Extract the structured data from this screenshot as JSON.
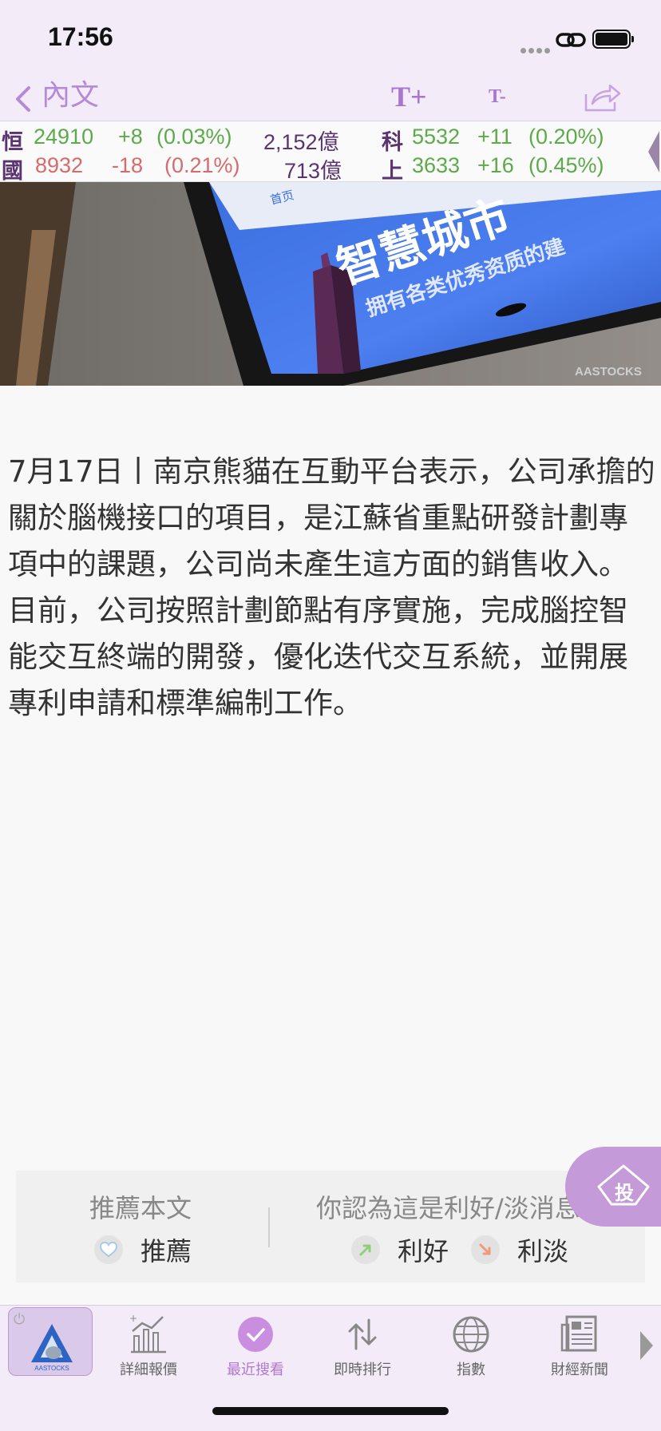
{
  "status_bar": {
    "time": "17:56"
  },
  "nav": {
    "title": "內文",
    "font_increase": "T+",
    "font_decrease": "T-"
  },
  "ticker": {
    "rows": [
      {
        "left": {
          "name": "恒",
          "value": "24910",
          "change": "+8",
          "percent": "(0.03%)",
          "turnover": "2,152億",
          "direction": "up"
        },
        "right": {
          "name": "科",
          "value": "5532",
          "change": "+11",
          "percent": "(0.20%)",
          "direction": "up"
        }
      },
      {
        "left": {
          "name": "國",
          "value": "8932",
          "change": "-18",
          "percent": "(0.21%)",
          "turnover": "713億",
          "direction": "down"
        },
        "right": {
          "name": "上",
          "value": "3633",
          "change": "+16",
          "percent": "(0.45%)",
          "direction": "up"
        }
      }
    ]
  },
  "hero": {
    "headline": "智慧城市",
    "subline": "拥有各类优秀资质的建",
    "tab_text": "首页",
    "watermark": "AASTOCKS"
  },
  "article": {
    "body": "7月17日丨南京熊貓在互動平台表示，公司承擔的關於腦機接口的項目，是江蘇省重點研發計劃專項中的課題，公司尚未產生這方面的銷售收入。目前，公司按照計劃節點有序實施，完成腦控智能交互終端的開發，優化迭代交互系統，並開展專利申請和標準編制工作。"
  },
  "recommend": {
    "left_title": "推薦本文",
    "recommend_label": "推薦",
    "right_title": "你認為這是利好/淡消息",
    "good_label": "利好",
    "bad_label": "利淡"
  },
  "invest_fab": {
    "label": "投"
  },
  "tab_bar": {
    "home_logo_text": "AASTOCKS",
    "tabs": [
      {
        "label": "詳細報價",
        "icon": "chart-icon"
      },
      {
        "label": "最近搜看",
        "icon": "checkmark-icon"
      },
      {
        "label": "即時排行",
        "icon": "sort-arrows-icon"
      },
      {
        "label": "指數",
        "icon": "globe-icon"
      },
      {
        "label": "財經新聞",
        "icon": "newspaper-icon"
      }
    ]
  },
  "colors": {
    "accent": "#b078d4",
    "up": "#5caa4a",
    "down": "#d66b6b",
    "header_bg": "#f3ebf8"
  }
}
